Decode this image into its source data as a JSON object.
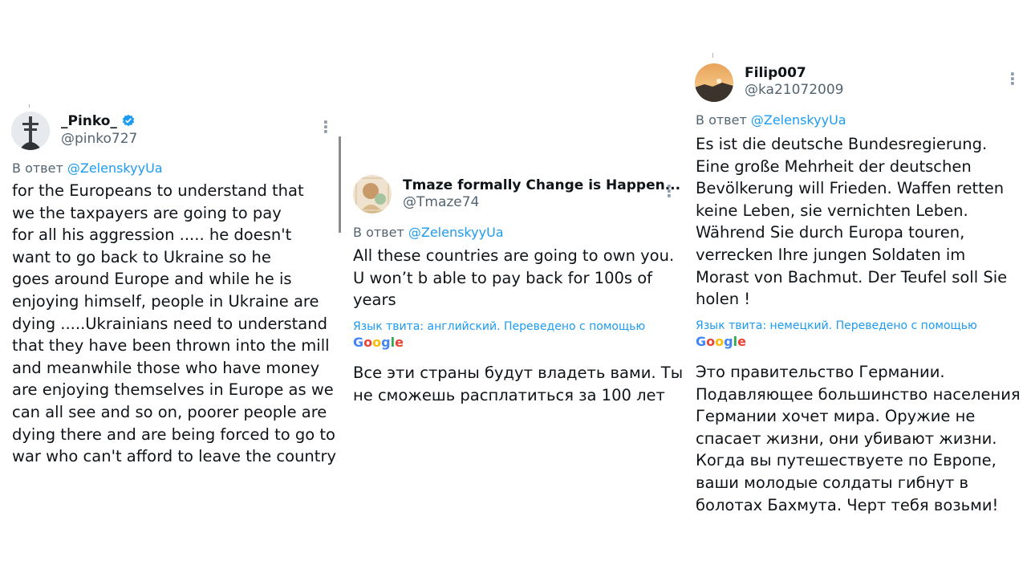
{
  "tweets": [
    {
      "name": "_Pinko_",
      "handle": "@pinko727",
      "verified": true,
      "reply_prefix": "В ответ",
      "reply_to": "@ZelenskyyUa",
      "body": "for the Europeans to understand that\nwe the taxpayers are going to pay\nfor all his aggression ..... he doesn't\nwant to go back to Ukraine so he\ngoes around Europe and while he is\nenjoying himself, people in Ukraine are\ndying .....Ukrainians need to understand\nthat they have been thrown into the mill\nand meanwhile those who have money\nare enjoying themselves in Europe as we\ncan all see and so on, poorer people are\ndying there and are being forced to go to\nwar who can't afford to leave the country"
    },
    {
      "name": "Tmaze formally Change is Happen...",
      "handle": "@Tmaze74",
      "verified": false,
      "reply_prefix": "В ответ",
      "reply_to": "@ZelenskyyUa",
      "body": "All these countries are going to own you.\nU won’t b able to pay back for 100s of\nyears",
      "translation_note": "Язык твита: английский. Переведено с помощью",
      "translated": "Все эти страны будут владеть вами. Ты\nне сможешь расплатиться за 100 лет"
    },
    {
      "name": "Filip007",
      "handle": "@ka21072009",
      "verified": false,
      "reply_prefix": "В ответ",
      "reply_to": "@ZelenskyyUa",
      "body": "Es ist die deutsche Bundesregierung.\nEine große Mehrheit der deutschen\nBevölkerung will Frieden. Waffen retten\nkeine Leben, sie vernichten Leben.\nWährend Sie durch Europa touren,\nverrecken Ihre jungen Soldaten im\nMorast von Bachmut. Der Teufel soll Sie\nholen !",
      "translation_note": "Язык твита: немецкий. Переведено с помощью",
      "translated": "Это правительство Германии.\nПодавляющее большинство населения\nГермании хочет мира. Оружие не\nспасает жизни, они убивают жизни.\nКогда вы путешествуете по Европе,\nваши молодые солдаты гибнут в\nболотах Бахмута. Черт тебя возьми!"
    }
  ],
  "google_logo": "Google",
  "more_icon_glyph": "⋮",
  "colors": {
    "text": "#0f1419",
    "secondary": "#536471",
    "link": "#1d9bf0",
    "verified": "#1d9bf0"
  }
}
